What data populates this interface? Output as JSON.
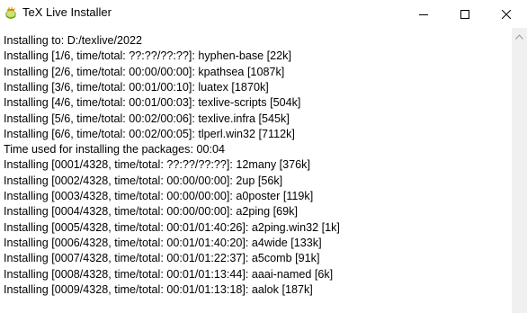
{
  "window": {
    "title": "TeX Live Installer",
    "controls": {
      "minimize_icon": "minimize-icon",
      "maximize_icon": "maximize-icon",
      "close_icon": "close-icon"
    }
  },
  "log": {
    "lines": [
      "Installing to: D:/texlive/2022",
      "Installing [1/6, time/total: ??:??/??:??]: hyphen-base [22k]",
      "Installing [2/6, time/total: 00:00/00:00]: kpathsea [1087k]",
      "Installing [3/6, time/total: 00:01/00:10]: luatex [1870k]",
      "Installing [4/6, time/total: 00:01/00:03]: texlive-scripts [504k]",
      "Installing [5/6, time/total: 00:02/00:06]: texlive.infra [545k]",
      "Installing [6/6, time/total: 00:02/00:05]: tlperl.win32 [7112k]",
      "Time used for installing the packages: 00:04",
      "Installing [0001/4328, time/total: ??:??/??:??]: 12many [376k]",
      "Installing [0002/4328, time/total: 00:00/00:00]: 2up [56k]",
      "Installing [0003/4328, time/total: 00:00/00:00]: a0poster [119k]",
      "Installing [0004/4328, time/total: 00:00/00:00]: a2ping [69k]",
      "Installing [0005/4328, time/total: 00:01/01:40:26]: a2ping.win32 [1k]",
      "Installing [0006/4328, time/total: 00:01/01:40:20]: a4wide [133k]",
      "Installing [0007/4328, time/total: 00:01/01:22:37]: a5comb [91k]",
      "Installing [0008/4328, time/total: 00:01/01:13:44]: aaai-named [6k]",
      "Installing [0009/4328, time/total: 00:01/01:13:18]: aalok [187k]"
    ]
  },
  "colors": {
    "background": "#ffffff",
    "text": "#000000",
    "scrollbar": "#f0f0f0"
  }
}
